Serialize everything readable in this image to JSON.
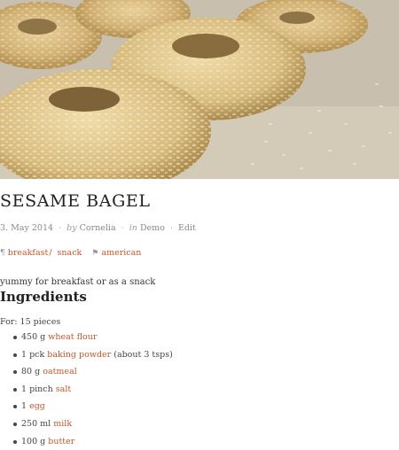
{
  "recipe": {
    "title": "SESAME BAGEL",
    "date": "3. May 2014",
    "by_label": "by",
    "author": "Cornelia",
    "in_label": "in",
    "category": "Demo",
    "edit_label": "Edit",
    "courses": [
      "breakfast",
      "snack"
    ],
    "cuisine": "american",
    "intro": "yummy for breakfast or as a snack",
    "ingredients_heading": "Ingredients",
    "yield": "For: 15 pieces",
    "ingredients": [
      {
        "qty": "450 g",
        "name": "wheat flour",
        "note": ""
      },
      {
        "qty": "1 pck",
        "name": "baking powder",
        "note": "(about 3 tsps)"
      },
      {
        "qty": "80 g",
        "name": "oatmeal",
        "note": ""
      },
      {
        "qty": "1 pinch",
        "name": "salt",
        "note": ""
      },
      {
        "qty": "1",
        "name": "egg",
        "note": ""
      },
      {
        "qty": "250 ml",
        "name": "milk",
        "note": ""
      },
      {
        "qty": "100 g",
        "name": "butter",
        "note": ""
      }
    ]
  },
  "icons": {
    "course": "fork-knife-icon",
    "cuisine": "flag-icon"
  },
  "colors": {
    "link": "#c0562f",
    "text": "#333333",
    "meta": "#888888"
  }
}
